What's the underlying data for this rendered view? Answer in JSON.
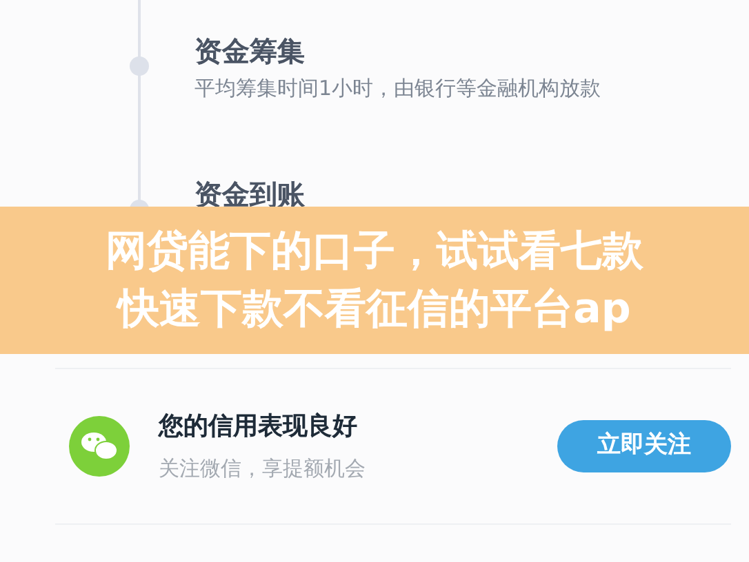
{
  "timeline": [
    {
      "title": "资金筹集",
      "description": "平均筹集时间1小时，由银行等金融机构放款"
    },
    {
      "title": "资金到账"
    }
  ],
  "banner": {
    "lines": [
      "网贷能下的口子，试试看七款",
      "快速下款不看征信的平台ap"
    ]
  },
  "follow_card": {
    "title": "您的信用表现良好",
    "subtitle": "关注微信，享提额机会",
    "button": "立即关注"
  }
}
